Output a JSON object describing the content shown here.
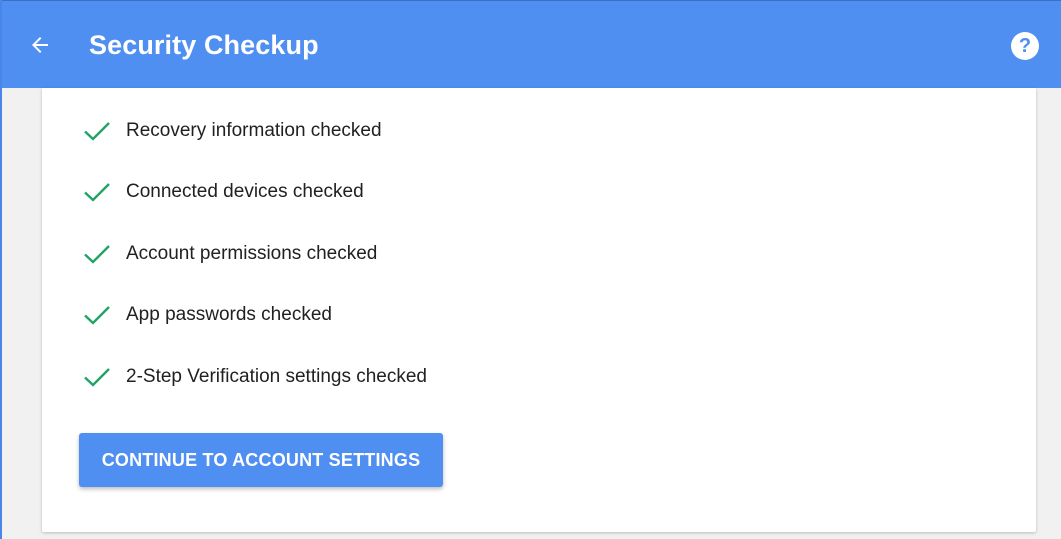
{
  "appbar": {
    "title": "Security Checkup",
    "back_icon": "arrow-left-icon",
    "help_icon": "help-circle-icon",
    "help_glyph": "?",
    "background_color": "#4f8ff1"
  },
  "checklist": {
    "check_icon": "checkmark-icon",
    "check_color": "#21a366",
    "items": [
      {
        "label": "Recovery information checked"
      },
      {
        "label": "Connected devices checked"
      },
      {
        "label": "Account permissions checked"
      },
      {
        "label": "App passwords checked"
      },
      {
        "label": "2-Step Verification settings checked"
      }
    ]
  },
  "actions": {
    "continue_label": "CONTINUE TO ACCOUNT SETTINGS",
    "button_color": "#4f8ff1"
  }
}
